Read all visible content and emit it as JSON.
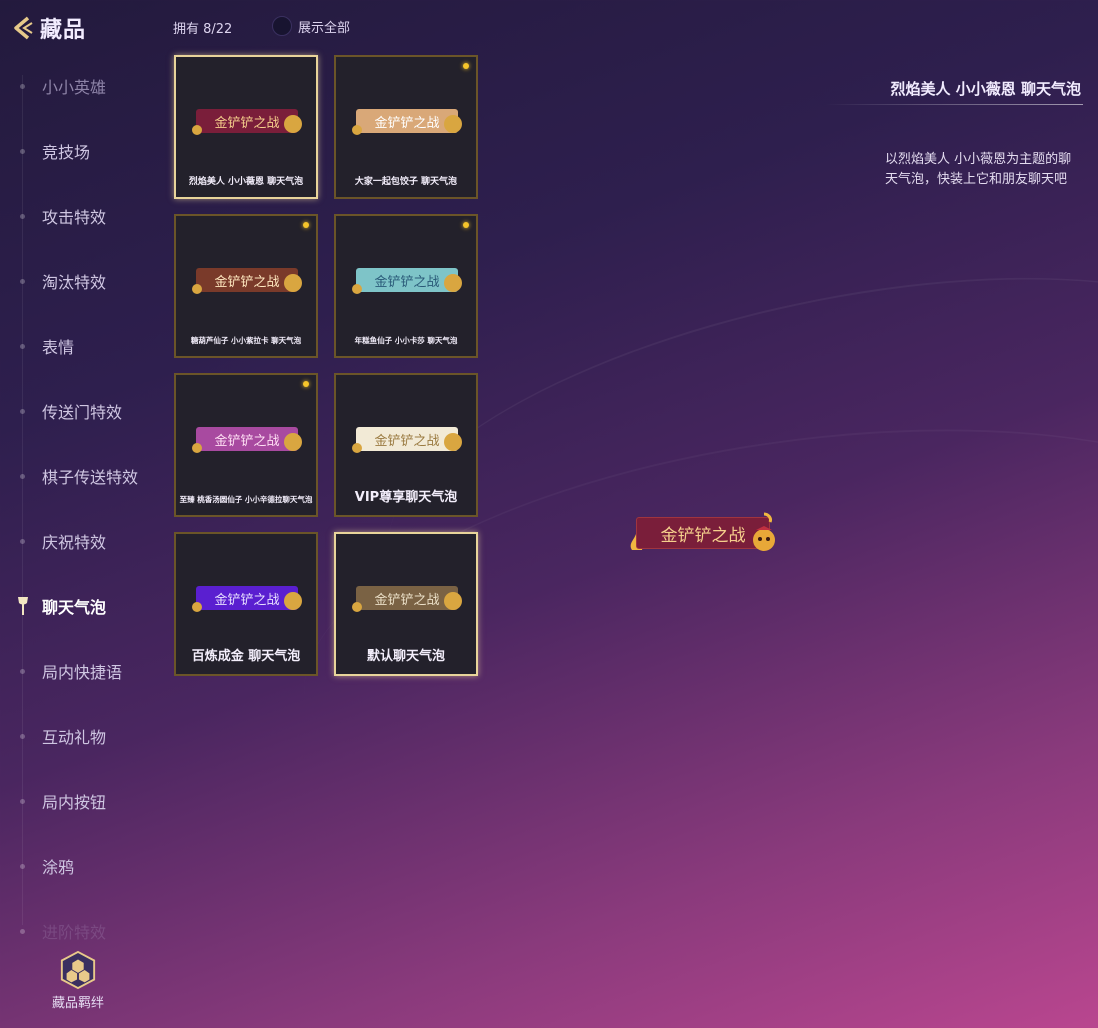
{
  "header": {
    "title": "藏品",
    "owned": "拥有 8/22",
    "show_all": "展示全部"
  },
  "sidebar": {
    "items": [
      {
        "label": "小小英雄",
        "state": "dim"
      },
      {
        "label": "竞技场",
        "state": "normal"
      },
      {
        "label": "攻击特效",
        "state": "normal"
      },
      {
        "label": "淘汰特效",
        "state": "normal"
      },
      {
        "label": "表情",
        "state": "normal"
      },
      {
        "label": "传送门特效",
        "state": "normal"
      },
      {
        "label": "棋子传送特效",
        "state": "normal"
      },
      {
        "label": "庆祝特效",
        "state": "normal"
      },
      {
        "label": "聊天气泡",
        "state": "active"
      },
      {
        "label": "局内快捷语",
        "state": "normal"
      },
      {
        "label": "互动礼物",
        "state": "normal"
      },
      {
        "label": "局内按钮",
        "state": "normal"
      },
      {
        "label": "涂鸦",
        "state": "normal"
      },
      {
        "label": "进阶特效",
        "state": "fade"
      }
    ],
    "bond_label": "藏品羁绊"
  },
  "bubble_text": "金铲铲之战",
  "items": [
    {
      "name": "烈焰美人 小小薇恩 聊天气泡",
      "bubble_color": "#7a1e3a",
      "text_color": "#f5cf8c",
      "new": false,
      "selected": true
    },
    {
      "name": "大家一起包饺子 聊天气泡",
      "bubble_color": "#d9a878",
      "text_color": "#ffffff",
      "new": true,
      "selected": false
    },
    {
      "name": "糖葫芦仙子 小小紫拉卡 聊天气泡",
      "bubble_color": "#7a3a2a",
      "text_color": "#ffe8c0",
      "new": true,
      "selected": false
    },
    {
      "name": "年糕鱼仙子 小小卡莎 聊天气泡",
      "bubble_color": "#7ec4c8",
      "text_color": "#2a5a78",
      "new": true,
      "selected": false
    },
    {
      "name": "至臻 桃香汤圆仙子 小小辛德拉聊天气泡",
      "bubble_color": "#a84aa0",
      "text_color": "#ffe0f4",
      "new": true,
      "selected": false
    },
    {
      "name": "VIP尊享聊天气泡",
      "bubble_color": "#f2ead6",
      "text_color": "#9a7a40",
      "new": false,
      "selected": false
    },
    {
      "name": "百炼成金 聊天气泡",
      "bubble_color": "#5a1fd0",
      "text_color": "#e8e0ff",
      "new": false,
      "selected": false
    },
    {
      "name": "默认聊天气泡",
      "bubble_color": "#7a6244",
      "text_color": "#ebe0c8",
      "new": false,
      "selected": true
    }
  ],
  "detail": {
    "title": "烈焰美人 小小薇恩 聊天气泡",
    "description": "以烈焰美人 小小薇恩为主题的聊天气泡，快装上它和朋友聊天吧",
    "preview_text": "金铲铲之战"
  }
}
